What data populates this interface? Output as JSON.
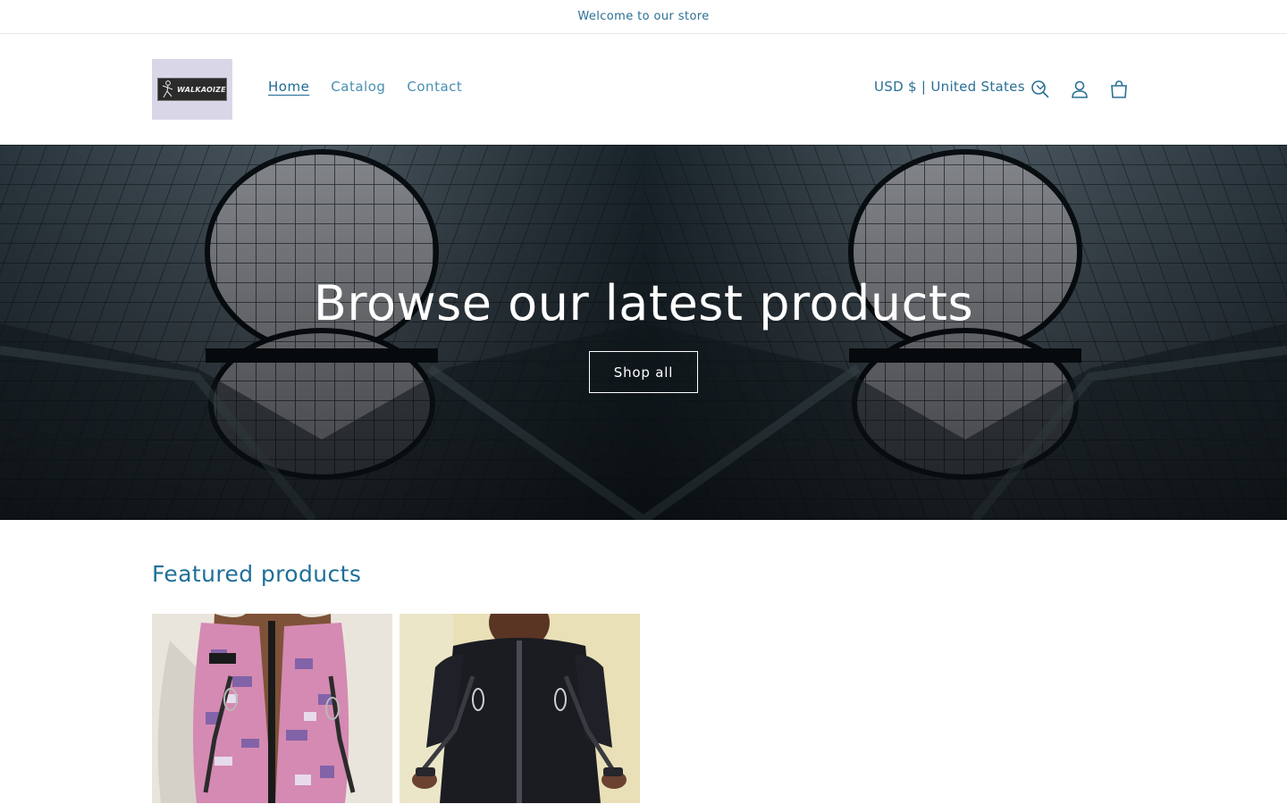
{
  "announcement": {
    "text": "Welcome to our store"
  },
  "header": {
    "logo": {
      "text": "WALKAOIZE",
      "icon": "stick-figure-logo"
    },
    "nav": [
      {
        "label": "Home",
        "active": true
      },
      {
        "label": "Catalog",
        "active": false
      },
      {
        "label": "Contact",
        "active": false
      }
    ],
    "currency": {
      "label": "USD $ | United States",
      "icon": "chevron-down-icon"
    },
    "icons": [
      "search-icon",
      "account-icon",
      "cart-icon"
    ]
  },
  "hero": {
    "title": "Browse our latest products",
    "button_label": "Shop all"
  },
  "featured": {
    "title": "Featured products",
    "products": [
      {
        "image": "camo-vest-product-photo"
      },
      {
        "image": "black-vest-product-photo"
      }
    ]
  },
  "colors": {
    "accent": "#1f6f98",
    "nav_link": "#4a8fb2",
    "hero_text": "#ffffff"
  }
}
